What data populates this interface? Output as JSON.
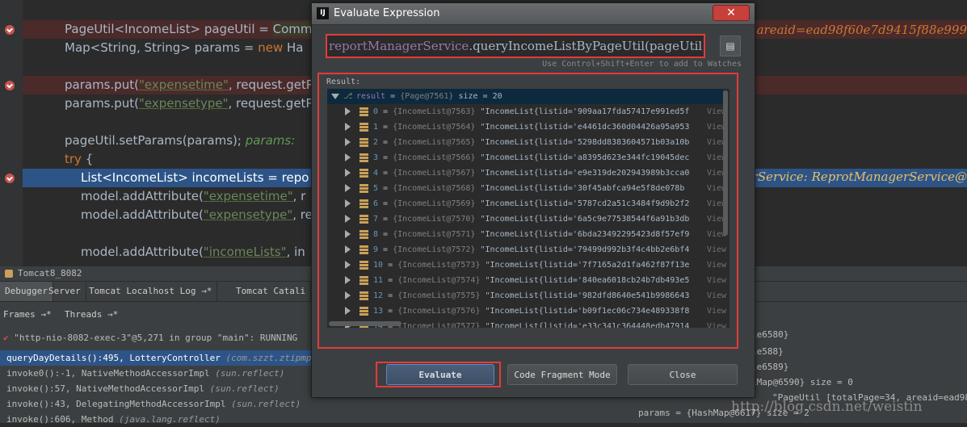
{
  "editor": {
    "lines": [
      {
        "kind": "bp-red",
        "parts": [
          "PageUtil<IncomeList> pageUtil = ",
          "Comm"
        ]
      },
      {
        "kind": "plain",
        "parts": [
          "Map<String, String> params = ",
          "new",
          " Ha"
        ]
      },
      {
        "kind": "bp-red",
        "parts": [
          "params.put(",
          "\"expensetime\"",
          ", request.getP"
        ]
      },
      {
        "kind": "plain",
        "parts": [
          "params.put(",
          "\"expensetype\"",
          ", request.getP"
        ]
      },
      {
        "kind": "plain",
        "parts": [
          "pageUtil.setParams(params);  ",
          "params: "
        ]
      },
      {
        "kind": "plain",
        "parts": [
          "try",
          " {"
        ]
      },
      {
        "kind": "bp-blue",
        "parts": [
          "List<IncomeList> incomeLists = ",
          "repo"
        ]
      },
      {
        "kind": "plain",
        "parts": [
          "model.addAttribute(",
          "\"expensetime\"",
          ", r"
        ]
      },
      {
        "kind": "plain",
        "parts": [
          "model.addAttribute(",
          "\"expensetype\"",
          ", re"
        ]
      },
      {
        "kind": "plain",
        "parts": [
          "model.addAttribute(",
          "\"incomeLists\"",
          ", in"
        ]
      }
    ],
    "right_areaid": "areaid=ead98f60e7d9415f88e999",
    "right_service": "erService: ReprotManagerService@"
  },
  "debug": {
    "title": "Tomcat8_8082",
    "tabs": [
      "Debugger",
      "Server",
      "Tomcat Localhost Log",
      "Tomcat Catali"
    ],
    "subtabs": [
      "Frames",
      "Threads"
    ],
    "thread": "\"http-nio-8082-exec-3\"@5,271 in group \"main\": RUNNING",
    "frames": [
      {
        "name": "queryDayDetails():495, LotteryController",
        "pkg": "(com.szzt.ztipmp.base"
      },
      {
        "name": "invoke0():-1, NativeMethodAccessorImpl",
        "pkg": "(sun.reflect)"
      },
      {
        "name": "invoke():57, NativeMethodAccessorImpl",
        "pkg": "(sun.reflect)"
      },
      {
        "name": "invoke():43, DelegatingMethodAccessorImpl",
        "pkg": "(sun.reflect)"
      },
      {
        "name": "invoke():606, Method",
        "pkg": "(java.lang.reflect)"
      }
    ],
    "right_vars": [
      "le6580}",
      "le588}",
      "le6589}",
      "lMap@6590}  size = 0",
      "\"PageUtil [totalPage=34, areaid=ead98f60e",
      "params = {HashMap@6617}  size = 2"
    ]
  },
  "dialog": {
    "title": "Evaluate Expression",
    "close": "✕",
    "expression_obj": "reportManagerService",
    "expression_rest": ".queryIncomeListByPageUtil(pageUtil",
    "hint": "Use Control+Shift+Enter to add to Watches",
    "history_icon": "history-icon",
    "result_label": "Result:",
    "root": {
      "name": "result",
      "type": "{Page@7561}",
      "size": "size = 20"
    },
    "items": [
      {
        "i": "0",
        "ref": "{IncomeList@7563}",
        "val": "\"IncomeList{listid='909aa17fda57417e991ed5f"
      },
      {
        "i": "1",
        "ref": "{IncomeList@7564}",
        "val": "\"IncomeList{listid='e4461dc360d04426a95a953"
      },
      {
        "i": "2",
        "ref": "{IncomeList@7565}",
        "val": "\"IncomeList{listid='5298dd8383604571b03a10b"
      },
      {
        "i": "3",
        "ref": "{IncomeList@7566}",
        "val": "\"IncomeList{listid='a8395d623e344fc19045dec"
      },
      {
        "i": "4",
        "ref": "{IncomeList@7567}",
        "val": "\"IncomeList{listid='e9e319de202943989b3cca0"
      },
      {
        "i": "5",
        "ref": "{IncomeList@7568}",
        "val": "\"IncomeList{listid='30f45abfca94e5f8de078b"
      },
      {
        "i": "6",
        "ref": "{IncomeList@7569}",
        "val": "\"IncomeList{listid='5787cd2a51c3484f9d9b2f2"
      },
      {
        "i": "7",
        "ref": "{IncomeList@7570}",
        "val": "\"IncomeList{listid='6a5c9e77538544f6a91b3db"
      },
      {
        "i": "8",
        "ref": "{IncomeList@7571}",
        "val": "\"IncomeList{listid='6bda23492295423d8f57ef9"
      },
      {
        "i": "9",
        "ref": "{IncomeList@7572}",
        "val": "\"IncomeList{listid='79499d992b3f4c4bb2e6bf4"
      },
      {
        "i": "10",
        "ref": "{IncomeList@7573}",
        "val": "\"IncomeList{listid='7f7165a2d1fa462f87f13e"
      },
      {
        "i": "11",
        "ref": "{IncomeList@7574}",
        "val": "\"IncomeList{listid='840ea6018cb24b7db493e5"
      },
      {
        "i": "12",
        "ref": "{IncomeList@7575}",
        "val": "\"IncomeList{listid='982dfd8640e541b9986643"
      },
      {
        "i": "13",
        "ref": "{IncomeList@7576}",
        "val": "\"IncomeList{listid='b09f1ec06c734e489338f8"
      },
      {
        "i": "14",
        "ref": "{IncomeList@7577}",
        "val": "\"IncomeList{listid='e33c341c364448edb47914"
      }
    ],
    "view_label": "View",
    "buttons": {
      "evaluate": "Evaluate",
      "fragment": "Code Fragment Mode",
      "close": "Close"
    }
  },
  "watermark": "http://blog.csdn.net/weistin"
}
